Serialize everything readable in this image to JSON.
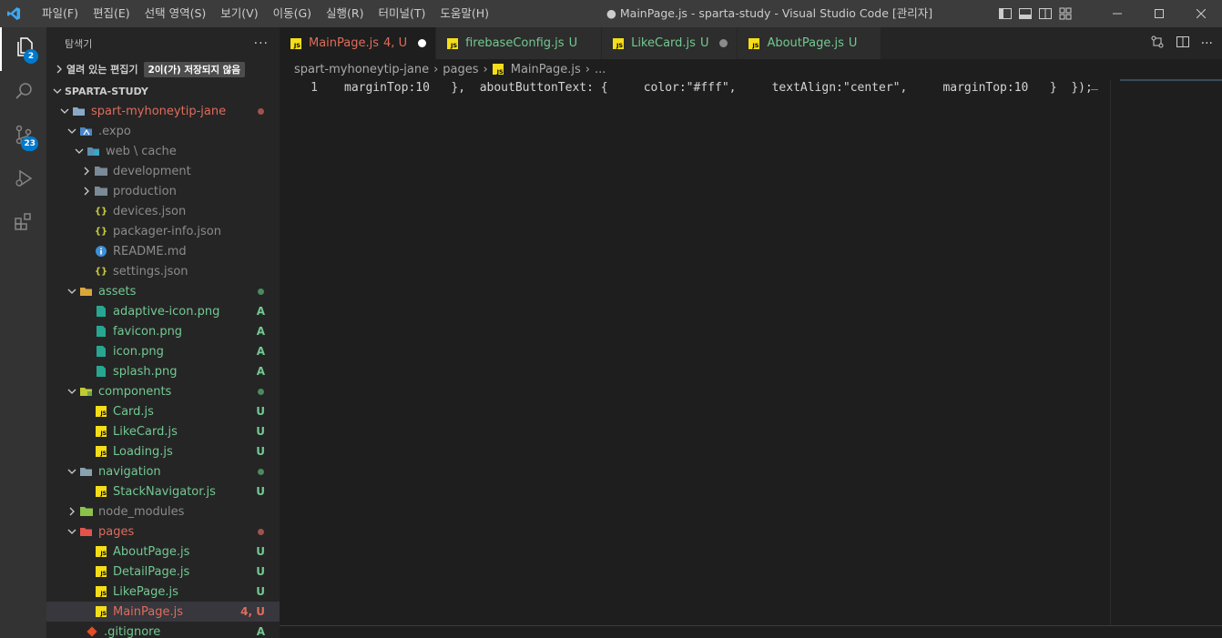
{
  "menu": [
    "파일(F)",
    "편집(E)",
    "선택 영역(S)",
    "보기(V)",
    "이동(G)",
    "실행(R)",
    "터미널(T)",
    "도움말(H)"
  ],
  "window_title": "● MainPage.js - sparta-study - Visual Studio Code [관리자]",
  "activity": {
    "explorer_badge": "2",
    "scm_badge": "23"
  },
  "sidebar": {
    "title": "탐색기",
    "more": "···",
    "open_editors_label": "열려 있는 편집기",
    "unsaved_label": "2이(가) 저장되지 않음",
    "workspace": "SPARTA-STUDY",
    "tree": [
      {
        "label": "spart-myhoneytip-jane",
        "status": ""
      },
      {
        "label": ".expo",
        "status": ""
      },
      {
        "label": "web",
        "sublabel": "cache",
        "status": ""
      },
      {
        "label": "development",
        "status": ""
      },
      {
        "label": "production",
        "status": ""
      },
      {
        "label": "devices.json",
        "status": ""
      },
      {
        "label": "packager-info.json",
        "status": ""
      },
      {
        "label": "README.md",
        "status": ""
      },
      {
        "label": "settings.json",
        "status": ""
      },
      {
        "label": "assets",
        "status": ""
      },
      {
        "label": "adaptive-icon.png",
        "status": "A"
      },
      {
        "label": "favicon.png",
        "status": "A"
      },
      {
        "label": "icon.png",
        "status": "A"
      },
      {
        "label": "splash.png",
        "status": "A"
      },
      {
        "label": "components",
        "status": ""
      },
      {
        "label": "Card.js",
        "status": "U"
      },
      {
        "label": "LikeCard.js",
        "status": "U"
      },
      {
        "label": "Loading.js",
        "status": "U"
      },
      {
        "label": "navigation",
        "status": ""
      },
      {
        "label": "StackNavigator.js",
        "status": "U"
      },
      {
        "label": "node_modules",
        "status": ""
      },
      {
        "label": "pages",
        "status": ""
      },
      {
        "label": "AboutPage.js",
        "status": "U"
      },
      {
        "label": "DetailPage.js",
        "status": "U"
      },
      {
        "label": "LikePage.js",
        "status": "U"
      },
      {
        "label": "MainPage.js",
        "status": "4, U"
      },
      {
        "label": ".gitignore",
        "status": "A"
      }
    ]
  },
  "tabs": [
    {
      "label": "MainPage.js",
      "status": "4, U"
    },
    {
      "label": "firebaseConfig.js",
      "status": "U"
    },
    {
      "label": "LikeCard.js",
      "status": "U"
    },
    {
      "label": "AboutPage.js",
      "status": "U"
    }
  ],
  "breadcrumbs": [
    "spart-myhoneytip-jane",
    "pages",
    "MainPage.js",
    "..."
  ],
  "editor": {
    "line_number": "1",
    "code": "marginTop:10   },  aboutButtonText: {     color:\"#fff\",     textAlign:\"center\",     marginTop:10   }  });"
  },
  "colors": {
    "accent": "#007acc",
    "modified_red": "#e06c5a",
    "untracked_green": "#73c991",
    "js_yellow": "#f5de19"
  }
}
